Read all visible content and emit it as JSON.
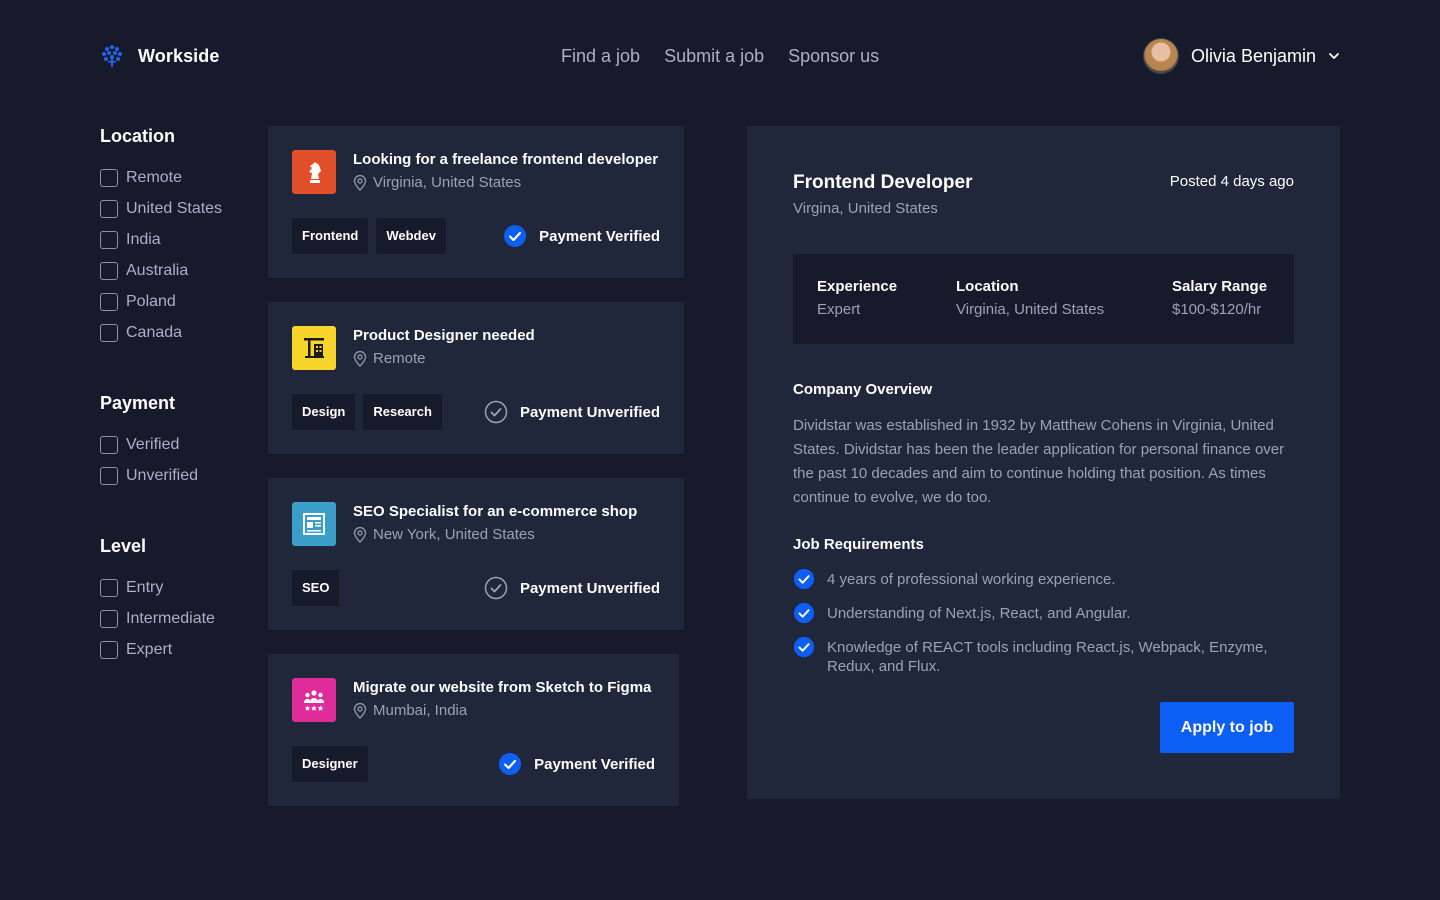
{
  "brand": {
    "name": "Workside",
    "logo_icon": "tree-logo-icon",
    "accent": "#0d5ef5"
  },
  "nav": {
    "items": [
      "Find a job",
      "Submit a job",
      "Sponsor us"
    ]
  },
  "user": {
    "name": "Olivia Benjamin"
  },
  "filters": {
    "location": {
      "title": "Location",
      "options": [
        "Remote",
        "United States",
        "India",
        "Australia",
        "Poland",
        "Canada"
      ]
    },
    "payment": {
      "title": "Payment",
      "options": [
        "Verified",
        "Unverified"
      ]
    },
    "level": {
      "title": "Level",
      "options": [
        "Entry",
        "Intermediate",
        "Expert"
      ]
    }
  },
  "jobs": [
    {
      "title": "Looking for a freelance frontend developer",
      "location": "Virginia, United States",
      "tags": [
        "Frontend",
        "Webdev"
      ],
      "payment": "Payment Verified",
      "verified": true,
      "logo_color": "#e04e2a",
      "logo_icon": "chess-knight-icon"
    },
    {
      "title": "Product Designer needed",
      "location": "Remote",
      "tags": [
        "Design",
        "Research"
      ],
      "payment": "Payment Unverified",
      "verified": false,
      "logo_color": "#f7d42a",
      "logo_icon": "construction-crane-icon"
    },
    {
      "title": "SEO Specialist for an e-commerce shop",
      "location": "New York, United States",
      "tags": [
        "SEO"
      ],
      "payment": "Payment Unverified",
      "verified": false,
      "logo_color": "#3a9ec9",
      "logo_icon": "press-newspaper-icon"
    },
    {
      "title": "Migrate our website from Sketch to Figma",
      "location": "Mumbai, India",
      "tags": [
        "Designer"
      ],
      "payment": "Payment Verified",
      "verified": true,
      "logo_color": "#e02b9a",
      "logo_icon": "team-stars-icon"
    }
  ],
  "detail": {
    "title": "Frontend Developer",
    "location": "Virgina, United States",
    "posted": "Posted 4 days ago",
    "stats": {
      "experience": {
        "label": "Experience",
        "value": "Expert"
      },
      "location": {
        "label": "Location",
        "value": "Virginia, United States"
      },
      "salary": {
        "label": "Salary Range",
        "value": "$100-$120/hr"
      }
    },
    "overview_title": "Company Overview",
    "overview": "Dividstar was established in 1932 by Matthew Cohens in Virginia, United States. Dividstar has been the leader application for personal finance over the past 10 decades and aim to continue holding that position. As times continue to evolve, we do too.",
    "requirements_title": "Job Requirements",
    "requirements": [
      "4 years of professional working experience.",
      "Understanding of Next.js, React, and Angular.",
      "Knowledge of REACT tools including React.js, Webpack, Enzyme, Redux, and Flux."
    ],
    "apply_label": "Apply to job"
  }
}
